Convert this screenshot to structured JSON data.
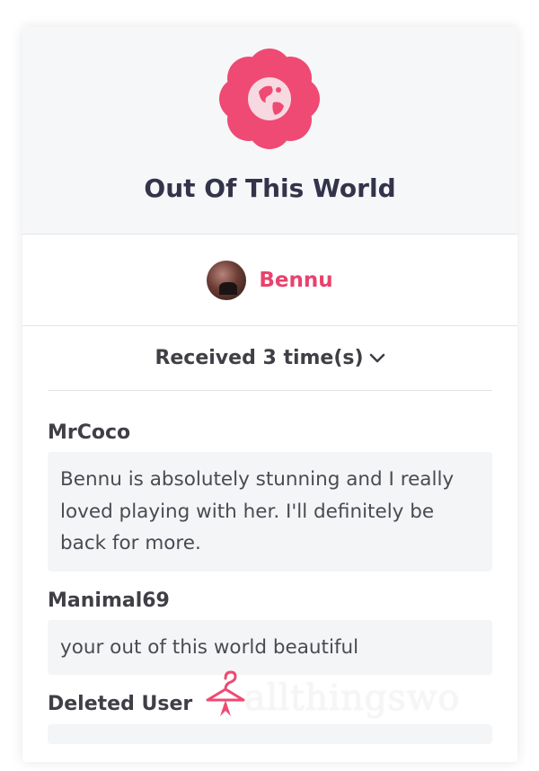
{
  "gift": {
    "title": "Out Of This World",
    "icon": "flower-globe-icon",
    "accent_color": "#ef4a73"
  },
  "sender": {
    "name": "Bennu",
    "avatar": "avatar-photo"
  },
  "received": {
    "label": "Received 3 time(s)",
    "icon": "chevron-down-icon"
  },
  "reviews": [
    {
      "user": "MrCoco",
      "text": "Bennu is absolutely stunning and I really loved playing with her. I'll definitely be back for more."
    },
    {
      "user": "Manimal69",
      "text": "your out of this world beautiful"
    },
    {
      "user": "Deleted User",
      "text": ""
    }
  ],
  "watermark": {
    "text": "allthingswo",
    "icon": "hanger-icon"
  }
}
